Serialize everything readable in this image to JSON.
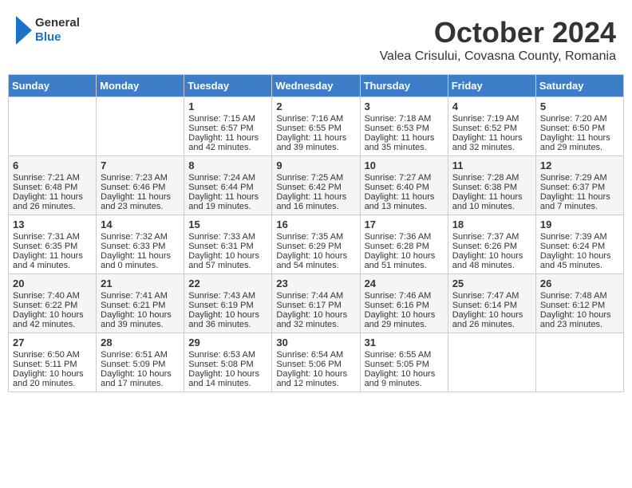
{
  "header": {
    "logo_line1": "General",
    "logo_line2": "Blue",
    "month": "October 2024",
    "location": "Valea Crisului, Covasna County, Romania"
  },
  "weekdays": [
    "Sunday",
    "Monday",
    "Tuesday",
    "Wednesday",
    "Thursday",
    "Friday",
    "Saturday"
  ],
  "weeks": [
    [
      {
        "day": "",
        "content": ""
      },
      {
        "day": "",
        "content": ""
      },
      {
        "day": "1",
        "content": "Sunrise: 7:15 AM\nSunset: 6:57 PM\nDaylight: 11 hours and 42 minutes."
      },
      {
        "day": "2",
        "content": "Sunrise: 7:16 AM\nSunset: 6:55 PM\nDaylight: 11 hours and 39 minutes."
      },
      {
        "day": "3",
        "content": "Sunrise: 7:18 AM\nSunset: 6:53 PM\nDaylight: 11 hours and 35 minutes."
      },
      {
        "day": "4",
        "content": "Sunrise: 7:19 AM\nSunset: 6:52 PM\nDaylight: 11 hours and 32 minutes."
      },
      {
        "day": "5",
        "content": "Sunrise: 7:20 AM\nSunset: 6:50 PM\nDaylight: 11 hours and 29 minutes."
      }
    ],
    [
      {
        "day": "6",
        "content": "Sunrise: 7:21 AM\nSunset: 6:48 PM\nDaylight: 11 hours and 26 minutes."
      },
      {
        "day": "7",
        "content": "Sunrise: 7:23 AM\nSunset: 6:46 PM\nDaylight: 11 hours and 23 minutes."
      },
      {
        "day": "8",
        "content": "Sunrise: 7:24 AM\nSunset: 6:44 PM\nDaylight: 11 hours and 19 minutes."
      },
      {
        "day": "9",
        "content": "Sunrise: 7:25 AM\nSunset: 6:42 PM\nDaylight: 11 hours and 16 minutes."
      },
      {
        "day": "10",
        "content": "Sunrise: 7:27 AM\nSunset: 6:40 PM\nDaylight: 11 hours and 13 minutes."
      },
      {
        "day": "11",
        "content": "Sunrise: 7:28 AM\nSunset: 6:38 PM\nDaylight: 11 hours and 10 minutes."
      },
      {
        "day": "12",
        "content": "Sunrise: 7:29 AM\nSunset: 6:37 PM\nDaylight: 11 hours and 7 minutes."
      }
    ],
    [
      {
        "day": "13",
        "content": "Sunrise: 7:31 AM\nSunset: 6:35 PM\nDaylight: 11 hours and 4 minutes."
      },
      {
        "day": "14",
        "content": "Sunrise: 7:32 AM\nSunset: 6:33 PM\nDaylight: 11 hours and 0 minutes."
      },
      {
        "day": "15",
        "content": "Sunrise: 7:33 AM\nSunset: 6:31 PM\nDaylight: 10 hours and 57 minutes."
      },
      {
        "day": "16",
        "content": "Sunrise: 7:35 AM\nSunset: 6:29 PM\nDaylight: 10 hours and 54 minutes."
      },
      {
        "day": "17",
        "content": "Sunrise: 7:36 AM\nSunset: 6:28 PM\nDaylight: 10 hours and 51 minutes."
      },
      {
        "day": "18",
        "content": "Sunrise: 7:37 AM\nSunset: 6:26 PM\nDaylight: 10 hours and 48 minutes."
      },
      {
        "day": "19",
        "content": "Sunrise: 7:39 AM\nSunset: 6:24 PM\nDaylight: 10 hours and 45 minutes."
      }
    ],
    [
      {
        "day": "20",
        "content": "Sunrise: 7:40 AM\nSunset: 6:22 PM\nDaylight: 10 hours and 42 minutes."
      },
      {
        "day": "21",
        "content": "Sunrise: 7:41 AM\nSunset: 6:21 PM\nDaylight: 10 hours and 39 minutes."
      },
      {
        "day": "22",
        "content": "Sunrise: 7:43 AM\nSunset: 6:19 PM\nDaylight: 10 hours and 36 minutes."
      },
      {
        "day": "23",
        "content": "Sunrise: 7:44 AM\nSunset: 6:17 PM\nDaylight: 10 hours and 32 minutes."
      },
      {
        "day": "24",
        "content": "Sunrise: 7:46 AM\nSunset: 6:16 PM\nDaylight: 10 hours and 29 minutes."
      },
      {
        "day": "25",
        "content": "Sunrise: 7:47 AM\nSunset: 6:14 PM\nDaylight: 10 hours and 26 minutes."
      },
      {
        "day": "26",
        "content": "Sunrise: 7:48 AM\nSunset: 6:12 PM\nDaylight: 10 hours and 23 minutes."
      }
    ],
    [
      {
        "day": "27",
        "content": "Sunrise: 6:50 AM\nSunset: 5:11 PM\nDaylight: 10 hours and 20 minutes."
      },
      {
        "day": "28",
        "content": "Sunrise: 6:51 AM\nSunset: 5:09 PM\nDaylight: 10 hours and 17 minutes."
      },
      {
        "day": "29",
        "content": "Sunrise: 6:53 AM\nSunset: 5:08 PM\nDaylight: 10 hours and 14 minutes."
      },
      {
        "day": "30",
        "content": "Sunrise: 6:54 AM\nSunset: 5:06 PM\nDaylight: 10 hours and 12 minutes."
      },
      {
        "day": "31",
        "content": "Sunrise: 6:55 AM\nSunset: 5:05 PM\nDaylight: 10 hours and 9 minutes."
      },
      {
        "day": "",
        "content": ""
      },
      {
        "day": "",
        "content": ""
      }
    ]
  ]
}
